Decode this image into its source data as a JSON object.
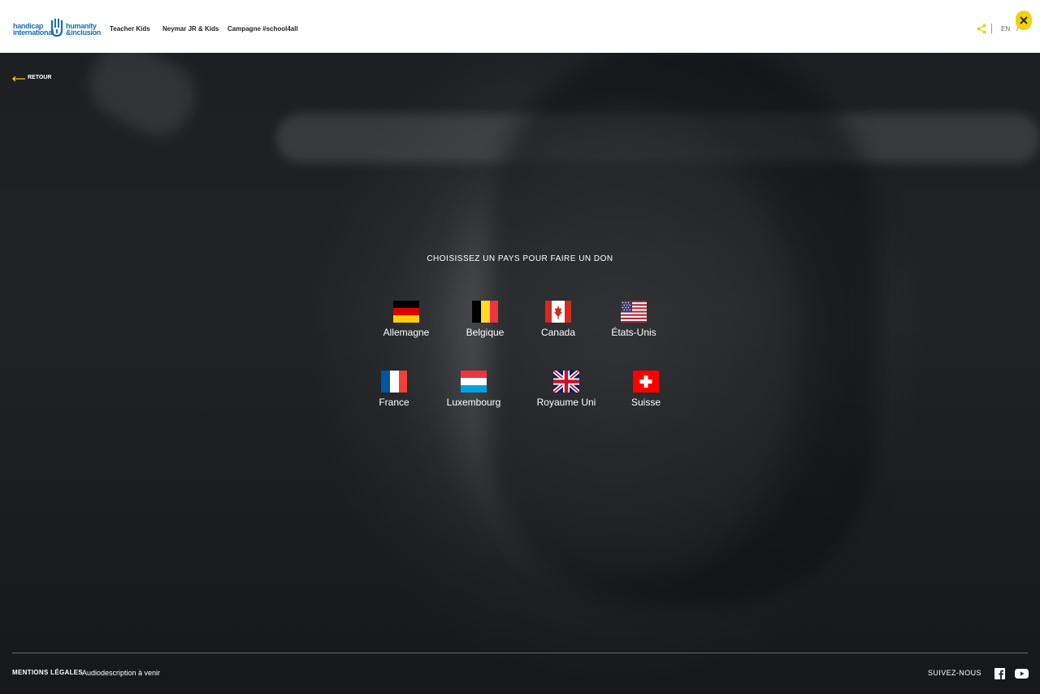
{
  "header": {
    "logo": {
      "left_top": "handicap",
      "left_bottom": "international",
      "right_top": "humanity",
      "right_bottom": "&inclusion"
    },
    "nav": [
      "Teacher Kids",
      "Neymar JR & Kids",
      "Campagne #school4all"
    ],
    "lang": "EN",
    "lang_extra": "/",
    "close_label": "X"
  },
  "back_label": "RETOUR",
  "heading": "CHOISISSEZ UN PAYS POUR FAIRE UN DON",
  "countries": [
    {
      "name": "Allemagne",
      "flag": "germany-flag"
    },
    {
      "name": "Belgique",
      "flag": "belgium-flag"
    },
    {
      "name": "Canada",
      "flag": "canada-flag"
    },
    {
      "name": "États-Unis",
      "flag": "usa-flag"
    },
    {
      "name": "France",
      "flag": "france-flag"
    },
    {
      "name": "Luxembourg",
      "flag": "luxembourg-flag"
    },
    {
      "name": "Royaume Uni",
      "flag": "uk-flag"
    },
    {
      "name": "Suisse",
      "flag": "switzerland-flag"
    }
  ],
  "footer": {
    "legal": "MENTIONS LÉGALES",
    "audio": "Audiodescription à venir",
    "follow": "SUIVEZ-NOUS"
  },
  "colors": {
    "accent": "#f3d10e",
    "brand_blue": "#1a6fb5"
  }
}
